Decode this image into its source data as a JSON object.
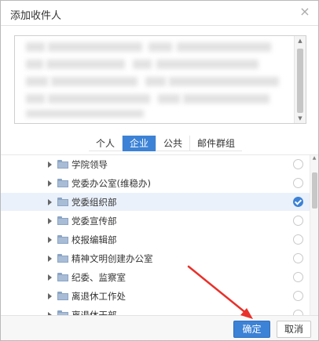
{
  "dialog": {
    "title": "添加收件人",
    "close_glyph": "×"
  },
  "tabs": [
    {
      "label": "个人",
      "active": false
    },
    {
      "label": "企业",
      "active": true
    },
    {
      "label": "公共",
      "active": false
    },
    {
      "label": "邮件群组",
      "active": false
    }
  ],
  "tree": {
    "items": [
      {
        "label": "学院领导",
        "checked": false
      },
      {
        "label": "党委办公室(维稳办)",
        "checked": false
      },
      {
        "label": "党委组织部",
        "checked": true
      },
      {
        "label": "党委宣传部",
        "checked": false
      },
      {
        "label": "校报编辑部",
        "checked": false
      },
      {
        "label": "精神文明创建办公室",
        "checked": false
      },
      {
        "label": "纪委、监察室",
        "checked": false
      },
      {
        "label": "离退休工作处",
        "checked": false
      },
      {
        "label": "离退休干部",
        "checked": false
      }
    ]
  },
  "footer": {
    "ok_label": "确定",
    "cancel_label": "取消"
  },
  "colors": {
    "accent": "#3c82d6",
    "annotation_arrow": "#e8312a"
  }
}
